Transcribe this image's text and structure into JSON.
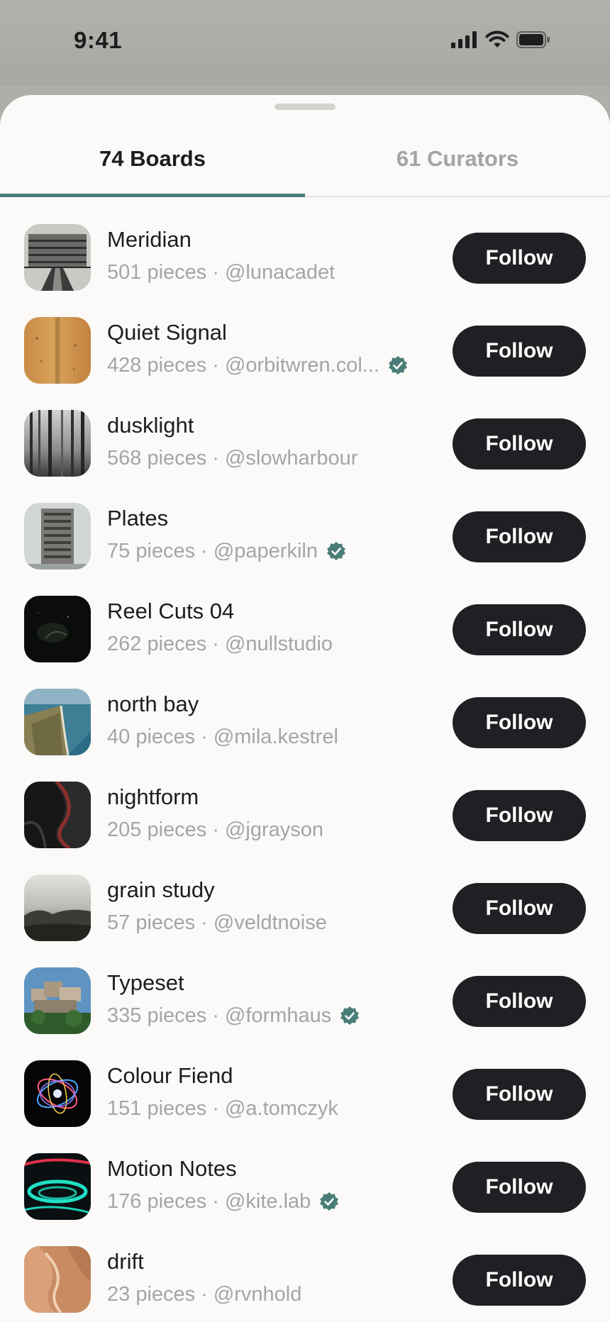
{
  "status_bar": {
    "time": "9:41"
  },
  "tabs": [
    {
      "label": "74 Boards",
      "active": true
    },
    {
      "label": "61 Curators",
      "active": false
    }
  ],
  "boards": [
    {
      "name": "Meridian",
      "pieces": "501 pieces",
      "handle": "@lunacadet",
      "verified": false,
      "follow_label": "Follow"
    },
    {
      "name": "Quiet Signal",
      "pieces": "428 pieces",
      "handle": "@orbitwren.col...",
      "verified": true,
      "follow_label": "Follow"
    },
    {
      "name": "dusklight",
      "pieces": "568 pieces",
      "handle": "@slowharbour",
      "verified": false,
      "follow_label": "Follow"
    },
    {
      "name": "Plates",
      "pieces": "75 pieces",
      "handle": "@paperkiln",
      "verified": true,
      "follow_label": "Follow"
    },
    {
      "name": "Reel Cuts 04",
      "pieces": "262 pieces",
      "handle": "@nullstudio",
      "verified": false,
      "follow_label": "Follow"
    },
    {
      "name": "north bay",
      "pieces": "40 pieces",
      "handle": "@mila.kestrel",
      "verified": false,
      "follow_label": "Follow"
    },
    {
      "name": "nightform",
      "pieces": "205 pieces",
      "handle": "@jgrayson",
      "verified": false,
      "follow_label": "Follow"
    },
    {
      "name": "grain study",
      "pieces": "57 pieces",
      "handle": "@veldtnoise",
      "verified": false,
      "follow_label": "Follow"
    },
    {
      "name": "Typeset",
      "pieces": "335 pieces",
      "handle": "@formhaus",
      "verified": true,
      "follow_label": "Follow"
    },
    {
      "name": "Colour Fiend",
      "pieces": "151 pieces",
      "handle": "@a.tomczyk",
      "verified": false,
      "follow_label": "Follow"
    },
    {
      "name": "Motion Notes",
      "pieces": "176 pieces",
      "handle": "@kite.lab",
      "verified": true,
      "follow_label": "Follow"
    },
    {
      "name": "drift",
      "pieces": "23 pieces",
      "handle": "@rvnhold",
      "verified": false,
      "follow_label": "Follow"
    }
  ],
  "colors": {
    "accent": "#4a7d77",
    "follow_button": "#1f2023",
    "meta_text": "#a5a5a5"
  }
}
